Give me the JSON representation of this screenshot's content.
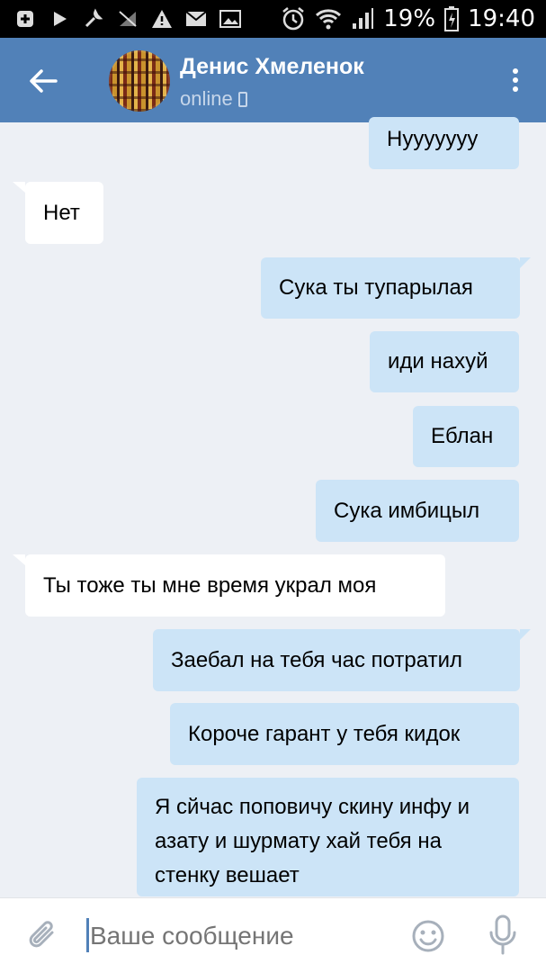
{
  "status_bar": {
    "battery": "19%",
    "time": "19:40"
  },
  "header": {
    "name": "Денис Хмеленок",
    "status": "online"
  },
  "messages": [
    {
      "dir": "out",
      "text": "Нууууууу"
    },
    {
      "dir": "in",
      "text": "Нет"
    },
    {
      "dir": "out",
      "text": "Сука ты тупарылая"
    },
    {
      "dir": "out",
      "text": "иди нахуй"
    },
    {
      "dir": "out",
      "text": "Еблан"
    },
    {
      "dir": "out",
      "text": "Сука имбицыл"
    },
    {
      "dir": "in",
      "text": "Ты тоже ты мне время украл моя"
    },
    {
      "dir": "out",
      "text": "Заебал на тебя час потратил"
    },
    {
      "dir": "out",
      "text": "Короче гарант у тебя кидок"
    },
    {
      "dir": "out",
      "text": "Я сйчас поповичу скину инфу и азату и шурмату хай тебя на стенку вешает"
    }
  ],
  "composer": {
    "placeholder": "Ваше сообщение"
  },
  "colors": {
    "header": "#5181b8",
    "background": "#edf0f5",
    "outgoing_bubble": "#cce4f7",
    "incoming_bubble": "#ffffff"
  },
  "icons": [
    "back-arrow-icon",
    "more-vert-icon",
    "attach-icon",
    "smile-icon",
    "mic-icon",
    "phone-icon"
  ]
}
